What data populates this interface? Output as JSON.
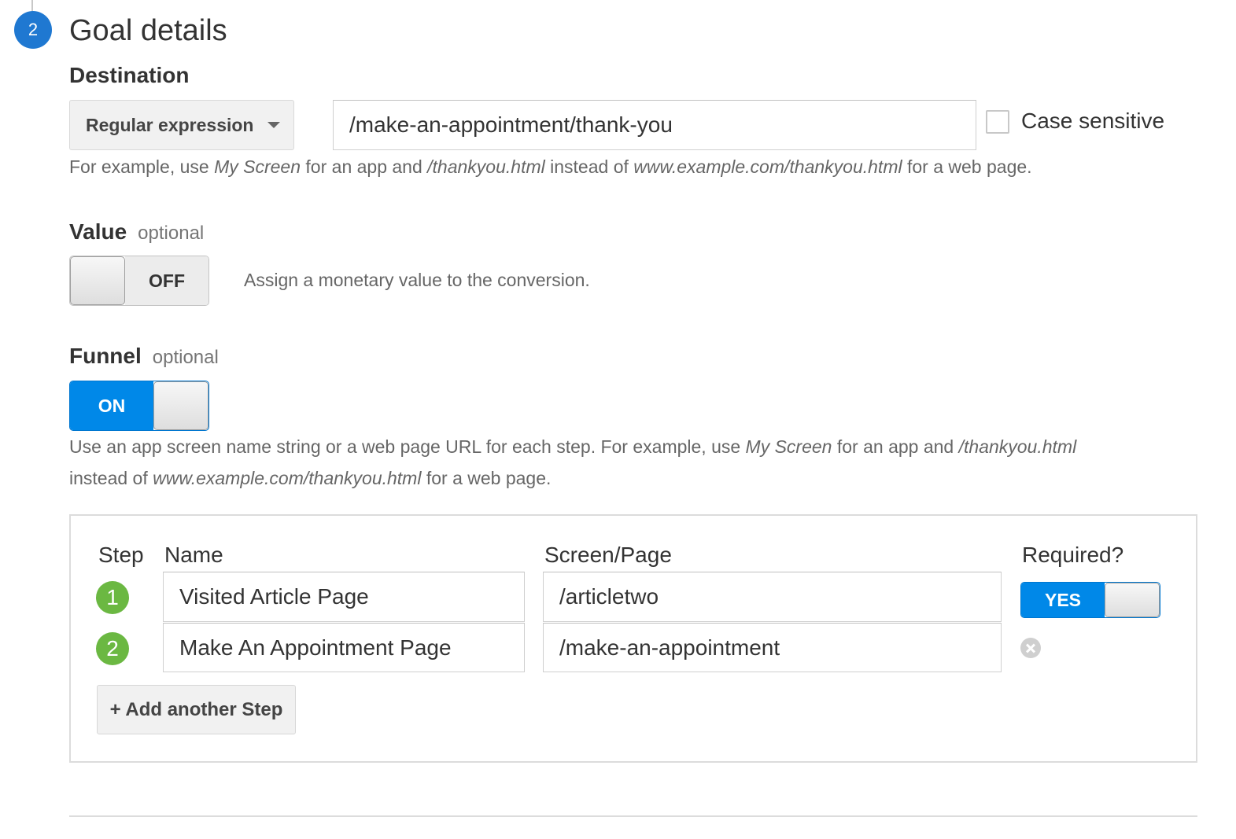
{
  "section": {
    "step_number": "2",
    "title": "Goal details"
  },
  "destination": {
    "label": "Destination",
    "match_type": "Regular expression",
    "value": "/make-an-appointment/thank-you",
    "case_sensitive_label": "Case sensitive",
    "case_sensitive_checked": false,
    "help": {
      "t1": "For example, use ",
      "i1": "My Screen",
      "t2": " for an app and ",
      "i2": "/thankyou.html",
      "t3": " instead of ",
      "i3": "www.example.com/thankyou.html",
      "t4": " for a web page."
    }
  },
  "value": {
    "label": "Value",
    "optional": "optional",
    "toggle_state": "OFF",
    "description": "Assign a monetary value to the conversion."
  },
  "funnel": {
    "label": "Funnel",
    "optional": "optional",
    "toggle_state": "ON",
    "help": {
      "t1": "Use an app screen name string or a web page URL for each step. For example, use ",
      "i1": "My Screen",
      "t2": " for an app and ",
      "i2": "/thankyou.html",
      "t3": "instead of ",
      "i3": "www.example.com/thankyou.html",
      "t4": " for a web page."
    },
    "columns": {
      "step": "Step",
      "name": "Name",
      "screen": "Screen/Page",
      "required": "Required?"
    },
    "steps": [
      {
        "number": "1",
        "name": "Visited Article Page",
        "screen": "/articletwo",
        "required": "YES"
      },
      {
        "number": "2",
        "name": "Make An Appointment Page",
        "screen": "/make-an-appointment"
      }
    ],
    "add_step_label": "+ Add another Step"
  },
  "colors": {
    "step_badge": "#1f78d1",
    "funnel_step_badge": "#6bb842",
    "toggle_on": "#0088e8"
  }
}
